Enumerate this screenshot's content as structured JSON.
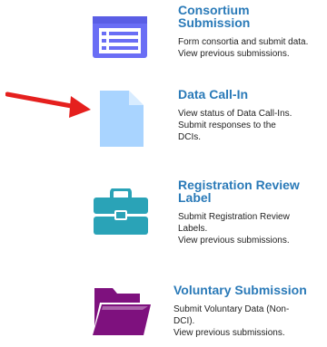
{
  "colors": {
    "title": "#2a7ab8",
    "consortium_icon": "#6a6ef5",
    "dci_icon": "#a9d4ff",
    "registration_icon": "#2aa3b7",
    "voluntary_icon": "#7e117e",
    "arrow": "#e5201e"
  },
  "items": [
    {
      "title_lines": [
        "Consortium",
        "Submission"
      ],
      "desc_lines": [
        "Form consortia and submit data.",
        "View previous submissions."
      ],
      "icon": "list-window-icon"
    },
    {
      "title_lines": [
        "Data Call-In"
      ],
      "desc_lines": [
        "View status of Data Call-Ins.",
        "Submit responses to the",
        "DCIs."
      ],
      "icon": "document-icon"
    },
    {
      "title_lines": [
        "Registration Review",
        "Label"
      ],
      "desc_lines": [
        "Submit Registration Review",
        "Labels.",
        "View previous submissions."
      ],
      "icon": "briefcase-icon"
    },
    {
      "title_lines": [
        "Voluntary Submission"
      ],
      "desc_lines": [
        "Submit Voluntary Data (Non-",
        "DCI).",
        "View previous submissions."
      ],
      "icon": "open-folder-icon"
    }
  ]
}
